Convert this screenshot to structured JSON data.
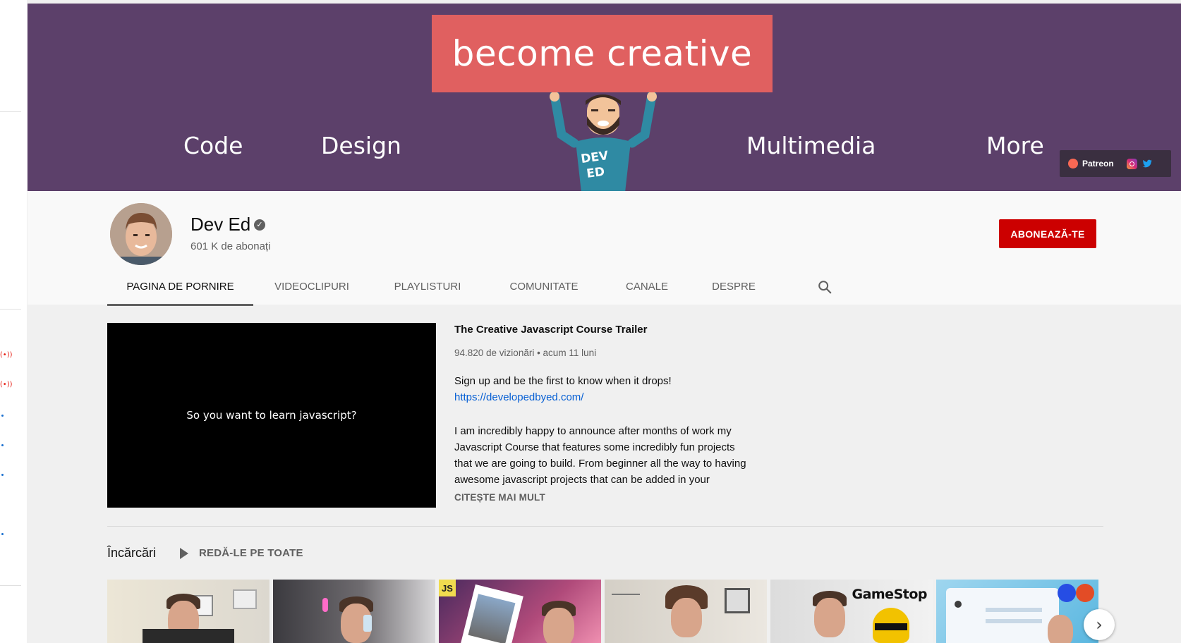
{
  "banner": {
    "headline": "become creative",
    "words": [
      "Code",
      "Design",
      "Multimedia",
      "More"
    ],
    "mascot_text": "DEV ED",
    "links": {
      "patreon": "Patreon",
      "instagram_icon": "instagram-icon",
      "twitter_icon": "twitter-icon"
    }
  },
  "channel": {
    "name": "Dev Ed",
    "subscribers": "601 K de abonați",
    "subscribe_label": "ABONEAZĂ-TE"
  },
  "tabs": [
    "PAGINA DE PORNIRE",
    "VIDEOCLIPURI",
    "PLAYLISTURI",
    "COMUNITATE",
    "CANALE",
    "DESPRE"
  ],
  "featured": {
    "video_text": "So you want to learn javascript?",
    "title": "The Creative Javascript Course Trailer",
    "meta": "94.820 de vizionări • acum 11 luni",
    "signup": "Sign up and be the first to know when it drops!",
    "link": "https://developedbyed.com/",
    "desc_lines": [
      "I am incredibly happy to announce after months of work my",
      "Javascript Course that features some incredibly fun projects",
      "that we are going to build. From beginner all the way to having",
      "awesome javascript projects that can be added in your"
    ],
    "read_more": "CITEȘTE MAI MULT"
  },
  "uploads": {
    "title": "Încărcări",
    "play_all": "REDĂ-LE PE TOATE",
    "badges": {
      "js": "JS",
      "gamestop": "GameStop"
    }
  },
  "colors": {
    "banner": "#5c406a",
    "sign": "#e06060",
    "subscribe": "#cc0000",
    "link": "#065fd4"
  }
}
